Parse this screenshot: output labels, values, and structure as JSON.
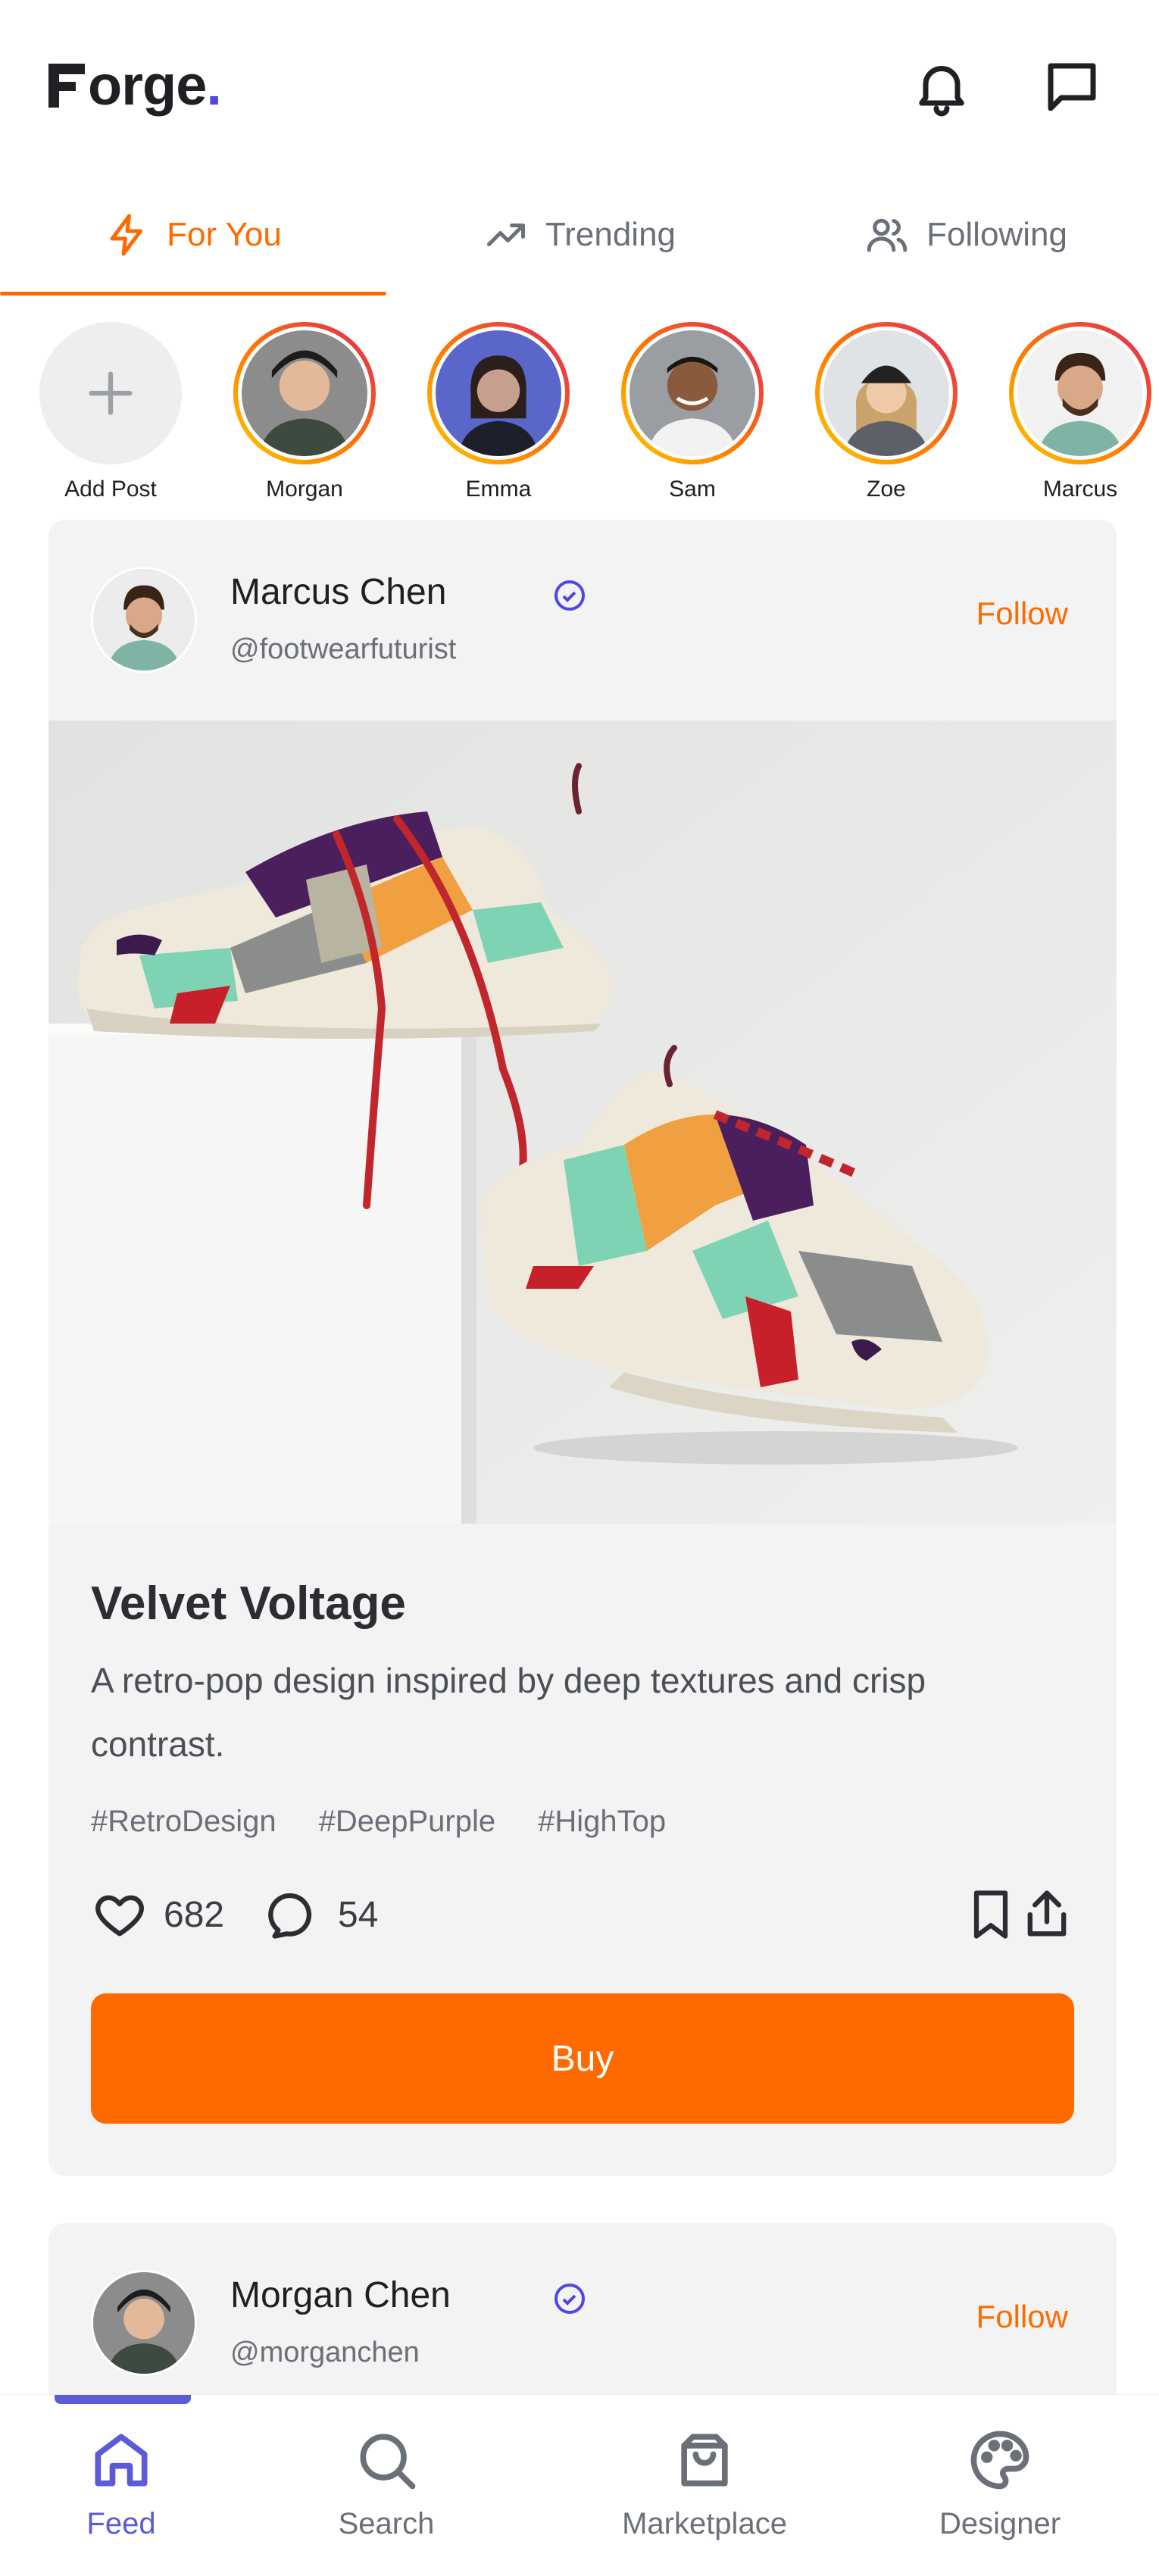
{
  "app": {
    "logo_text": "orge",
    "logo_dot": "."
  },
  "header": {
    "icons": [
      "bell-icon",
      "message-icon"
    ]
  },
  "tabs": [
    {
      "label": "For You",
      "icon": "lightning-icon",
      "active": true
    },
    {
      "label": "Trending",
      "icon": "trending-up-icon",
      "active": false
    },
    {
      "label": "Following",
      "icon": "users-icon",
      "active": false
    }
  ],
  "stories": {
    "add_label": "Add Post",
    "items": [
      {
        "name": "Morgan"
      },
      {
        "name": "Emma"
      },
      {
        "name": "Sam"
      },
      {
        "name": "Zoe"
      },
      {
        "name": "Marcus"
      }
    ]
  },
  "posts": [
    {
      "author": "Marcus Chen",
      "handle": "@footwearfuturist",
      "follow_label": "Follow",
      "title": "Velvet Voltage",
      "description": "A retro-pop design inspired by deep textures and crisp contrast.",
      "tags": [
        "#RetroDesign",
        "#DeepPurple",
        "#HighTop"
      ],
      "likes": "682",
      "comments": "54",
      "buy_label": "Buy"
    },
    {
      "author": "Morgan Chen",
      "handle": "@morganchen",
      "follow_label": "Follow"
    }
  ],
  "bottom_nav": [
    {
      "label": "Feed",
      "icon": "home-icon",
      "active": true
    },
    {
      "label": "Search",
      "icon": "search-icon",
      "active": false
    },
    {
      "label": "Marketplace",
      "icon": "shopping-bag-icon",
      "active": false
    },
    {
      "label": "Designer",
      "icon": "palette-icon",
      "active": false
    }
  ],
  "colors": {
    "accent": "#ff6a00",
    "nav_active": "#5b5bd6",
    "verified": "#4f46e5"
  }
}
